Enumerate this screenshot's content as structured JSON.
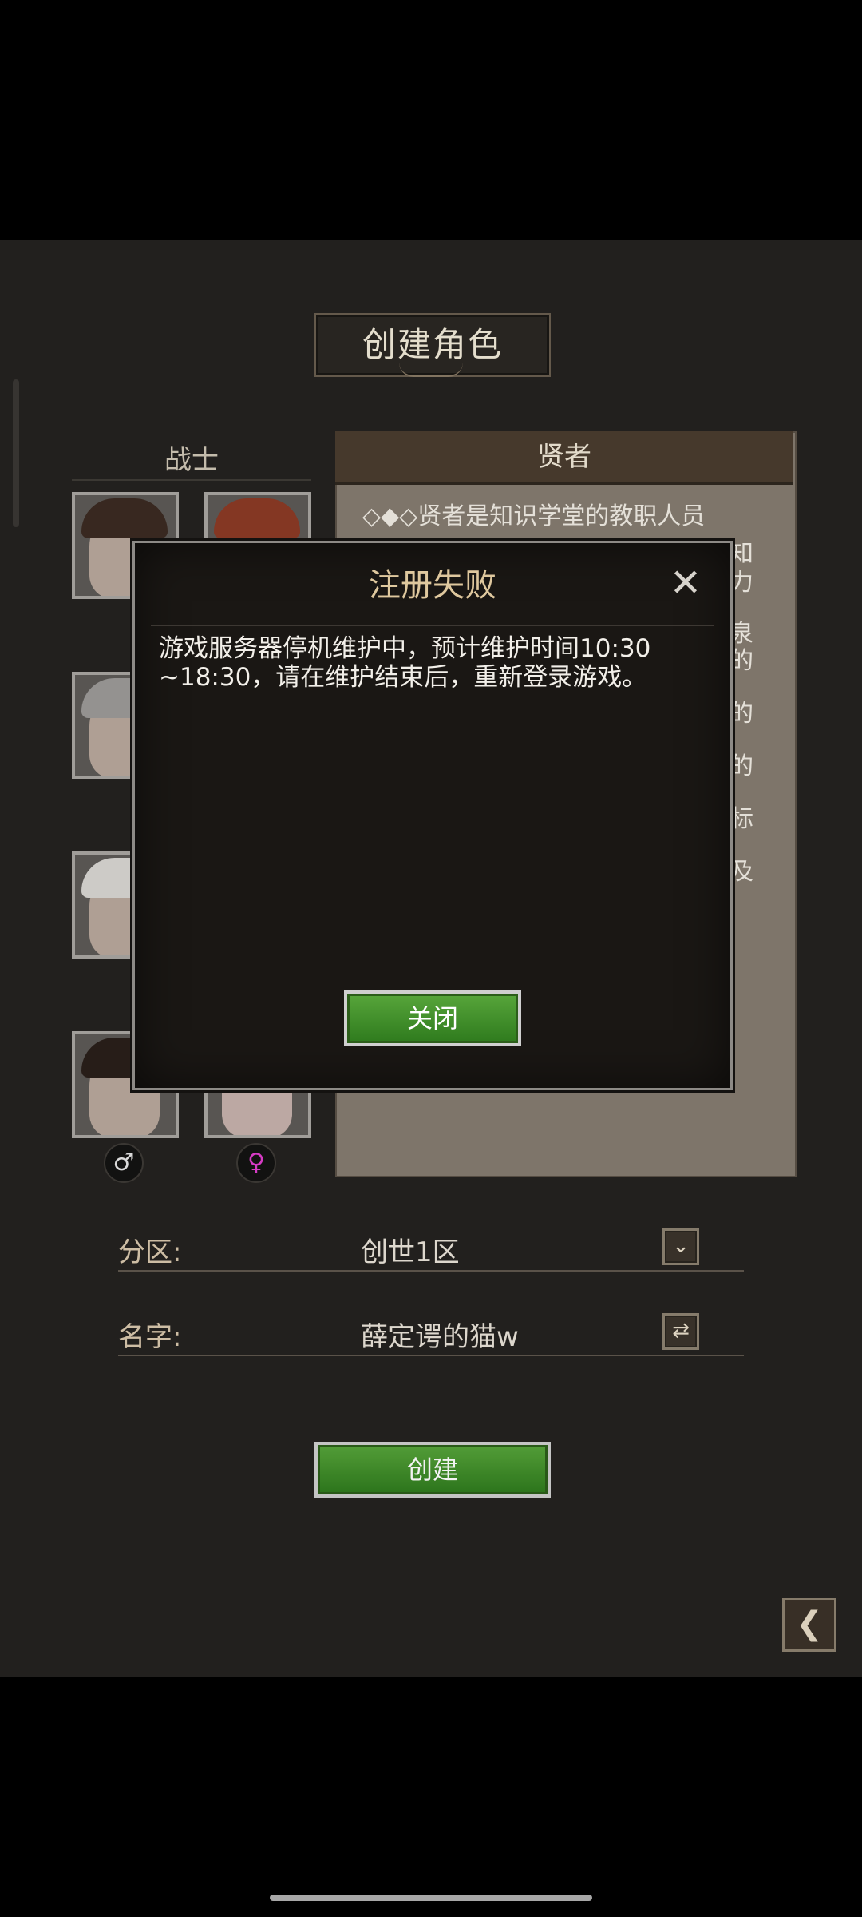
{
  "page": {
    "title": "创建角色"
  },
  "class_column": {
    "label": "战士"
  },
  "selected_class": {
    "name": "贤者",
    "description_first_line": "◇◆◇贤者是知识学堂的教职人员",
    "visible_fragments": [
      "知",
      "力",
      "泉",
      "的",
      "的",
      "的",
      "标",
      "及"
    ]
  },
  "gender": {
    "male_symbol": "♂",
    "female_symbol": "♀"
  },
  "form": {
    "zone_label": "分区:",
    "zone_value": "创世1区",
    "name_label": "名字:",
    "name_value": "薛定谔的猫w"
  },
  "actions": {
    "create_label": "创建"
  },
  "dialog": {
    "title": "注册失败",
    "message": "游戏服务器停机维护中，预计维护时间10:30 ~18:30，请在维护结束后，重新登录游戏。",
    "close_button_label": "关闭",
    "close_icon": "✕"
  },
  "icons": {
    "dropdown": "chevron-down-icon",
    "refresh": "refresh-icon",
    "back": "back-arrow-icon"
  }
}
